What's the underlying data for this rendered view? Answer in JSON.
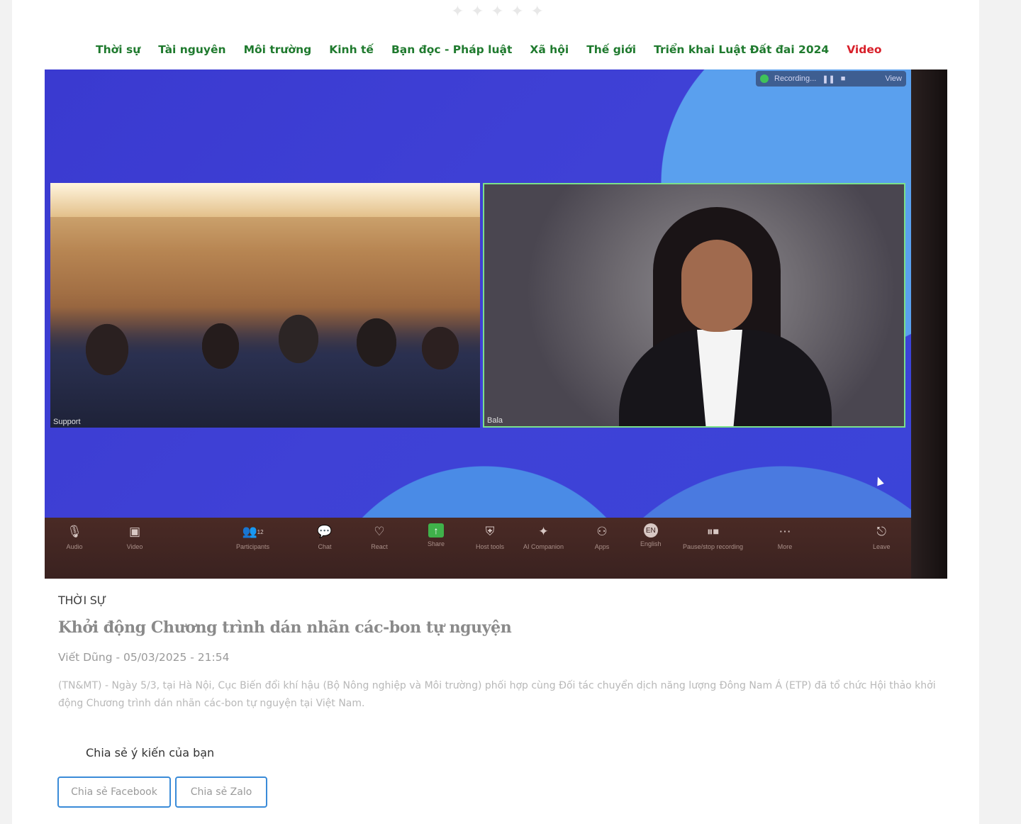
{
  "nav": {
    "items": [
      {
        "label": "Thời sự"
      },
      {
        "label": "Tài nguyên"
      },
      {
        "label": "Môi trường"
      },
      {
        "label": "Kinh tế"
      },
      {
        "label": "Bạn đọc - Pháp luật"
      },
      {
        "label": "Xã hội"
      },
      {
        "label": "Thế giới"
      },
      {
        "label": "Triển khai Luật Đất đai 2024"
      },
      {
        "label": "Video"
      }
    ],
    "highlight_color": "#d8202a",
    "link_color": "#1f7a2e"
  },
  "media": {
    "recording_label": "Recording...",
    "view_label": "View",
    "tile_left_label": "Support",
    "tile_right_label": "Bala",
    "toolbar": [
      {
        "label": "Audio",
        "icon": "microphone-icon"
      },
      {
        "label": "Video",
        "icon": "camera-icon"
      },
      {
        "label": "Participants",
        "icon": "participants-icon",
        "count": "12"
      },
      {
        "label": "Chat",
        "icon": "chat-icon"
      },
      {
        "label": "React",
        "icon": "heart-icon"
      },
      {
        "label": "Share",
        "icon": "share-icon"
      },
      {
        "label": "Host tools",
        "icon": "shield-icon"
      },
      {
        "label": "AI Companion",
        "icon": "sparkle-icon"
      },
      {
        "label": "Apps",
        "icon": "apps-icon"
      },
      {
        "label": "English",
        "icon": "language-icon",
        "badge": "EN"
      },
      {
        "label": "Pause/stop recording",
        "icon": "pause-stop-icon"
      },
      {
        "label": "More",
        "icon": "more-icon"
      },
      {
        "label": "Leave",
        "icon": "leave-icon"
      }
    ]
  },
  "article": {
    "section": "THỜI SỰ",
    "title": "Khởi động Chương trình dán nhãn các-bon tự nguyện",
    "byline": "Viết Dũng - 05/03/2025 - 21:54",
    "lead": "(TN&MT) - Ngày 5/3, tại Hà Nội, Cục Biến đổi khí hậu (Bộ Nông nghiệp và Môi trường) phối hợp cùng Đối tác chuyển dịch năng lượng Đông Nam Á (ETP) đã tổ chức Hội thảo khởi động Chương trình dán nhãn các-bon tự nguyện tại Việt Nam."
  },
  "share": {
    "label": "Chia sẻ ý kiến của bạn",
    "facebook": "Chia sẻ Facebook",
    "zalo": "Chia sẻ Zalo",
    "button_border_color": "#3a8bd8"
  }
}
